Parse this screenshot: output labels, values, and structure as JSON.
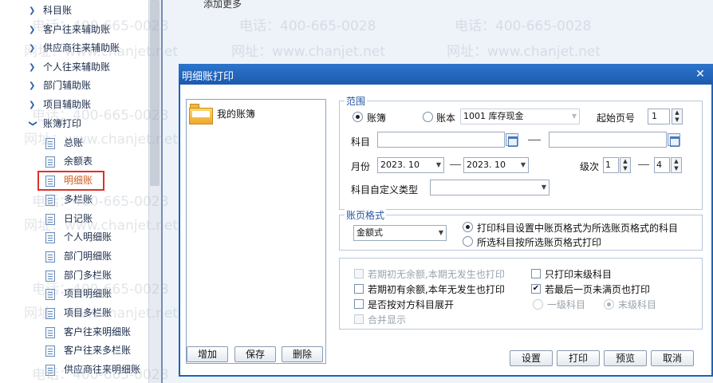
{
  "sidebar": {
    "items": [
      {
        "label": "科目账",
        "type": "folder"
      },
      {
        "label": "客户往来辅助账",
        "type": "folder"
      },
      {
        "label": "供应商往来辅助账",
        "type": "folder"
      },
      {
        "label": "个人往来辅助账",
        "type": "folder"
      },
      {
        "label": "部门辅助账",
        "type": "folder"
      },
      {
        "label": "项目辅助账",
        "type": "folder"
      },
      {
        "label": "账簿打印",
        "type": "open-folder"
      },
      {
        "label": "总账",
        "type": "leaf"
      },
      {
        "label": "余额表",
        "type": "leaf"
      },
      {
        "label": "明细账",
        "type": "leaf",
        "selected": true
      },
      {
        "label": "多栏账",
        "type": "leaf"
      },
      {
        "label": "日记账",
        "type": "leaf"
      },
      {
        "label": "个人明细账",
        "type": "leaf"
      },
      {
        "label": "部门明细账",
        "type": "leaf"
      },
      {
        "label": "部门多栏账",
        "type": "leaf"
      },
      {
        "label": "项目明细账",
        "type": "leaf"
      },
      {
        "label": "项目多栏账",
        "type": "leaf"
      },
      {
        "label": "客户往来明细账",
        "type": "leaf"
      },
      {
        "label": "客户往来多栏账",
        "type": "leaf"
      },
      {
        "label": "供应商往来明细账",
        "type": "leaf"
      }
    ],
    "icons": {
      "folder": "chevron-right-icon",
      "open_folder": "chevron-down-icon",
      "leaf": "document-icon"
    },
    "highlight_color": "#e0302a"
  },
  "main": {
    "add_more": "添加更多"
  },
  "watermark": {
    "phone": "电话：400-665-0028",
    "site": "网址：www.chanjet.net"
  },
  "dialog": {
    "title": "明细账打印",
    "close_icon": "close-icon",
    "book_panel": {
      "item": "我的账簿",
      "icon": "folder-icon"
    },
    "book_buttons": {
      "add": "增加",
      "save": "保存",
      "delete": "删除"
    },
    "range": {
      "title": "范围",
      "radio_ledger": "账簿",
      "radio_account": "账本",
      "account_select": "1001  库存现金",
      "start_page_label": "起始页号",
      "start_page_value": "1",
      "subject_label": "科目",
      "subject_from": "",
      "subject_to": "",
      "month_label": "月份",
      "month_from": "2023. 10",
      "month_to": "2023. 10",
      "level_label": "级次",
      "level_from": "1",
      "level_to": "4",
      "custom_type_label": "科目自定义类型",
      "custom_type_value": ""
    },
    "page_format": {
      "title": "账页格式",
      "format_select": "金额式",
      "option1": "打印科目设置中账页格式为所选账页格式的科目",
      "option2": "所选科目按所选账页格式打印"
    },
    "options": {
      "opt1": "若期初无余额,本期无发生也打印",
      "opt2": "若期初有余额,本年无发生也打印",
      "opt3": "是否按对方科目展开",
      "opt4": "合并显示",
      "opt5": "只打印末级科目",
      "opt6": "若最后一页未满页也打印",
      "sub1": "一级科目",
      "sub2": "末级科目"
    },
    "footer": {
      "settings": "设置",
      "print": "打印",
      "preview": "预览",
      "cancel": "取消"
    }
  },
  "colors": {
    "dialog_title_bar": "#1f62b7",
    "group_title": "#2456a6",
    "selected_text": "#d05a1e"
  }
}
